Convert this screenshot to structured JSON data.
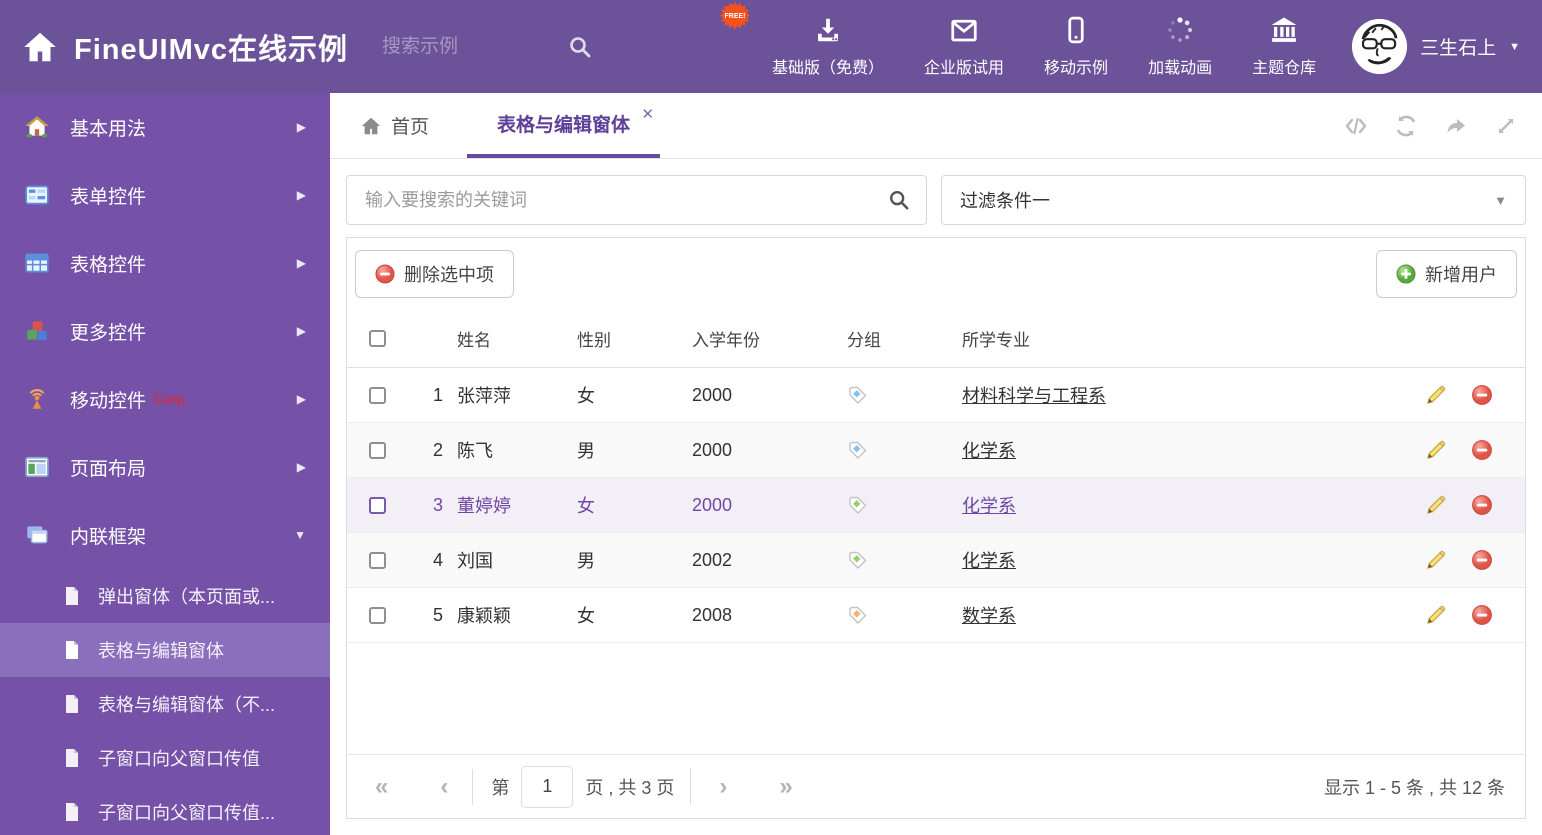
{
  "colors": {
    "header_bg": "#6b5299",
    "sidebar_bg": "#7551a8",
    "sidebar_active": "#8a6fbd",
    "accent_purple": "#6b4a9e",
    "selected_row_text": "#7246a5",
    "delete_red": "#d9534f",
    "add_green": "#5cb85c",
    "tag_blue": "#85c1ee",
    "tag_green": "#9acb6e",
    "tag_orange": "#f5b06a",
    "free_badge": "#f4511e"
  },
  "header": {
    "title": "FineUIMvc在线示例",
    "search_placeholder": "搜索示例",
    "free_badge": "FREE!",
    "nav_items": [
      {
        "label": "基础版（免费）",
        "icon": "download-icon"
      },
      {
        "label": "企业版试用",
        "icon": "envelope-icon"
      },
      {
        "label": "移动示例",
        "icon": "mobile-icon"
      },
      {
        "label": "加载动画",
        "icon": "spinner-icon"
      },
      {
        "label": "主题仓库",
        "icon": "bank-icon"
      }
    ],
    "user": {
      "name": "三生石上",
      "icon": "avatar"
    }
  },
  "sidebar": {
    "items": [
      {
        "label": "基本用法",
        "icon": "home-icon",
        "arrow": "▶"
      },
      {
        "label": "表单控件",
        "icon": "form-icon",
        "arrow": "▶"
      },
      {
        "label": "表格控件",
        "icon": "table-icon",
        "arrow": "▶"
      },
      {
        "label": "更多控件",
        "icon": "cubes-icon",
        "arrow": "▶"
      },
      {
        "label": "移动控件",
        "badge": "Corp.",
        "icon": "antenna-icon",
        "arrow": "▶"
      },
      {
        "label": "页面布局",
        "icon": "layout-icon",
        "arrow": "▶"
      },
      {
        "label": "内联框架",
        "icon": "frames-icon",
        "arrow": "▼",
        "expanded": true
      }
    ],
    "subitems": [
      {
        "label": "弹出窗体（本页面或..."
      },
      {
        "label": "表格与编辑窗体",
        "active": true
      },
      {
        "label": "表格与编辑窗体（不..."
      },
      {
        "label": "子窗口向父窗口传值"
      },
      {
        "label": "子窗口向父窗口传值..."
      }
    ]
  },
  "tabs": {
    "home": {
      "label": "首页",
      "icon": "home-icon"
    },
    "active": {
      "label": "表格与编辑窗体",
      "close": "✕"
    },
    "tools": [
      "code-icon",
      "refresh-icon",
      "share-icon",
      "expand-icon"
    ]
  },
  "filter": {
    "search_placeholder": "输入要搜索的关键词",
    "dropdown_value": "过滤条件一"
  },
  "grid": {
    "toolbar": {
      "delete_button": "删除选中项",
      "add_button": "新增用户"
    },
    "columns": {
      "name": "姓名",
      "gender": "性别",
      "year": "入学年份",
      "group": "分组",
      "major": "所学专业"
    },
    "rows": [
      {
        "index": "1",
        "name": "张萍萍",
        "gender": "女",
        "year": "2000",
        "tag": "blue",
        "major": "材料科学与工程系",
        "selected": false
      },
      {
        "index": "2",
        "name": "陈飞",
        "gender": "男",
        "year": "2000",
        "tag": "blue",
        "major": "化学系",
        "selected": false
      },
      {
        "index": "3",
        "name": "董婷婷",
        "gender": "女",
        "year": "2000",
        "tag": "green",
        "major": "化学系",
        "selected": true
      },
      {
        "index": "4",
        "name": "刘国",
        "gender": "男",
        "year": "2002",
        "tag": "green",
        "major": "化学系",
        "selected": false
      },
      {
        "index": "5",
        "name": "康颖颖",
        "gender": "女",
        "year": "2008",
        "tag": "orange",
        "major": "数学系",
        "selected": false
      }
    ],
    "pagination": {
      "first": "«",
      "prev": "‹",
      "page_label_before": "第",
      "page_value": "1",
      "page_label_after": "页 , 共 3 页",
      "next": "›",
      "last": "»",
      "summary": "显示 1 - 5 条 , 共 12 条"
    }
  }
}
